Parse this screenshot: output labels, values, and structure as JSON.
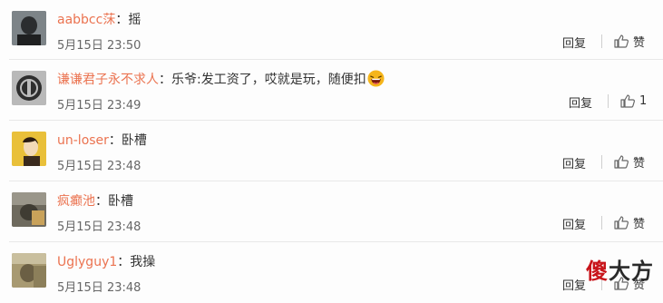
{
  "comments": [
    {
      "user": "aabbcc莯",
      "colon": "：",
      "text": "摇",
      "time": "5月15日 23:50",
      "reply": "回复",
      "like": "赞"
    },
    {
      "user": "谦谦君子永不求人",
      "colon": "：",
      "text": "乐爷:发工资了，哎就是玩，随便扣",
      "time": "5月15日 23:49",
      "reply": "回复",
      "like": "1"
    },
    {
      "user": "un-loser",
      "colon": "：",
      "text": "卧槽",
      "time": "5月15日 23:48",
      "reply": "回复",
      "like": "赞"
    },
    {
      "user": "疯癫池",
      "colon": "：",
      "text": "卧槽",
      "time": "5月15日 23:48",
      "reply": "回复",
      "like": "赞"
    },
    {
      "user": "Uglyguy1",
      "colon": "：",
      "text": "我操",
      "time": "5月15日 23:48",
      "reply": "回复",
      "like": "赞"
    }
  ],
  "watermark": {
    "first": "傻",
    "rest": "大方"
  },
  "icons": {
    "like": "thumb-up-icon",
    "emoji": "laughing-emoji-icon"
  },
  "colors": {
    "username": "#eb7350",
    "watermark_accent": "#c8141a"
  }
}
